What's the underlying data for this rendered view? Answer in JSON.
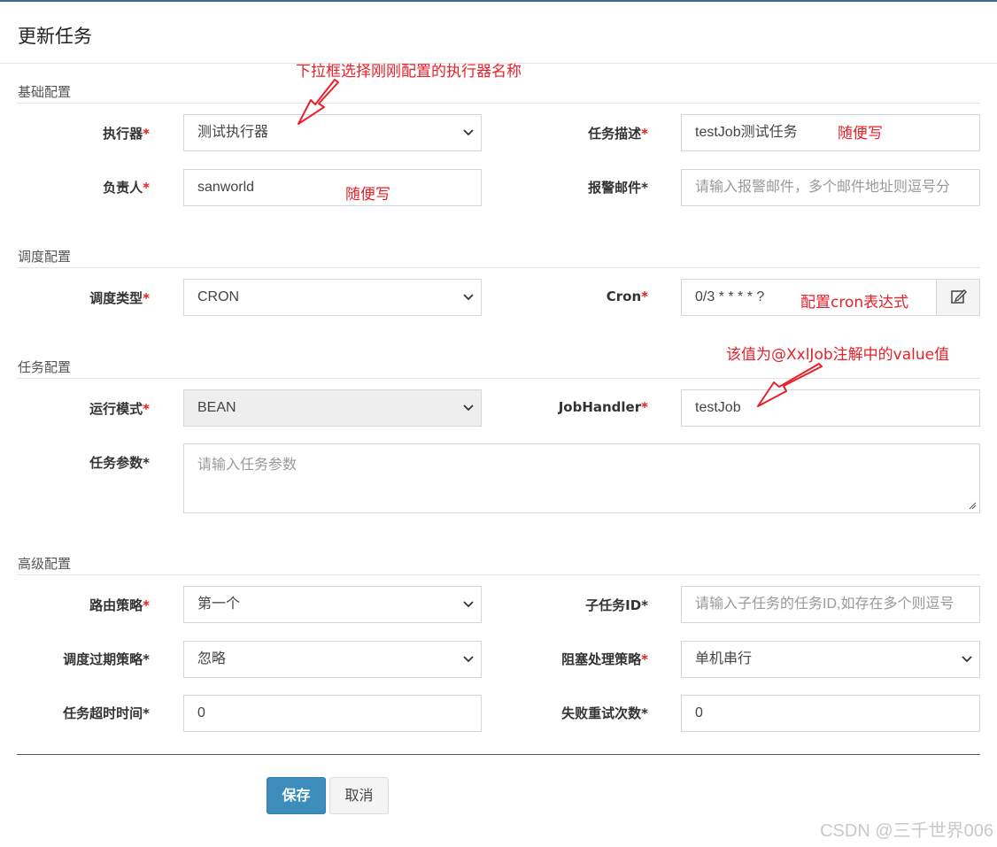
{
  "dialog": {
    "title": "更新任务"
  },
  "sections": {
    "basic": "基础配置",
    "schedule": "调度配置",
    "task": "任务配置",
    "advanced": "高级配置"
  },
  "fields": {
    "executor": {
      "label": "执行器",
      "value": "测试执行器"
    },
    "job_desc": {
      "label": "任务描述",
      "value": "testJob测试任务"
    },
    "owner": {
      "label": "负责人",
      "value": "sanworld"
    },
    "alarm_email": {
      "label": "报警邮件*",
      "placeholder": "请输入报警邮件，多个邮件地址则逗号分"
    },
    "schedule_type": {
      "label": "调度类型",
      "value": "CRON"
    },
    "cron": {
      "label": "Cron",
      "value": "0/3 * * * * ?"
    },
    "run_mode": {
      "label": "运行模式",
      "value": "BEAN"
    },
    "job_handler": {
      "label": "JobHandler",
      "value": "testJob"
    },
    "job_params": {
      "label": "任务参数*",
      "placeholder": "请输入任务参数"
    },
    "route_strategy": {
      "label": "路由策略",
      "value": "第一个"
    },
    "child_job_id": {
      "label": "子任务ID*",
      "placeholder": "请输入子任务的任务ID,如存在多个则逗号"
    },
    "misfire_strategy": {
      "label": "调度过期策略*",
      "value": "忽略"
    },
    "block_strategy": {
      "label": "阻塞处理策略",
      "value": "单机串行"
    },
    "timeout": {
      "label": "任务超时时间*",
      "value": "0"
    },
    "fail_retry": {
      "label": "失败重试次数*",
      "value": "0"
    }
  },
  "required_mark": "*",
  "buttons": {
    "save": "保存",
    "cancel": "取消"
  },
  "annotations": {
    "executor_hint": "下拉框选择刚刚配置的执行器名称",
    "desc_hint": "随便写",
    "owner_hint": "随便写",
    "cron_hint": "配置cron表达式",
    "handler_hint": "该值为@XxlJob注解中的value值"
  },
  "watermark": "CSDN @三千世界006",
  "colors": {
    "accent": "#3c8dbc",
    "required": "#dd2222",
    "annotation": "#e8202a"
  },
  "icons": {
    "select": "chevron-down-icon",
    "cron_edit": "edit-icon",
    "textarea": "resize-handle-icon"
  }
}
